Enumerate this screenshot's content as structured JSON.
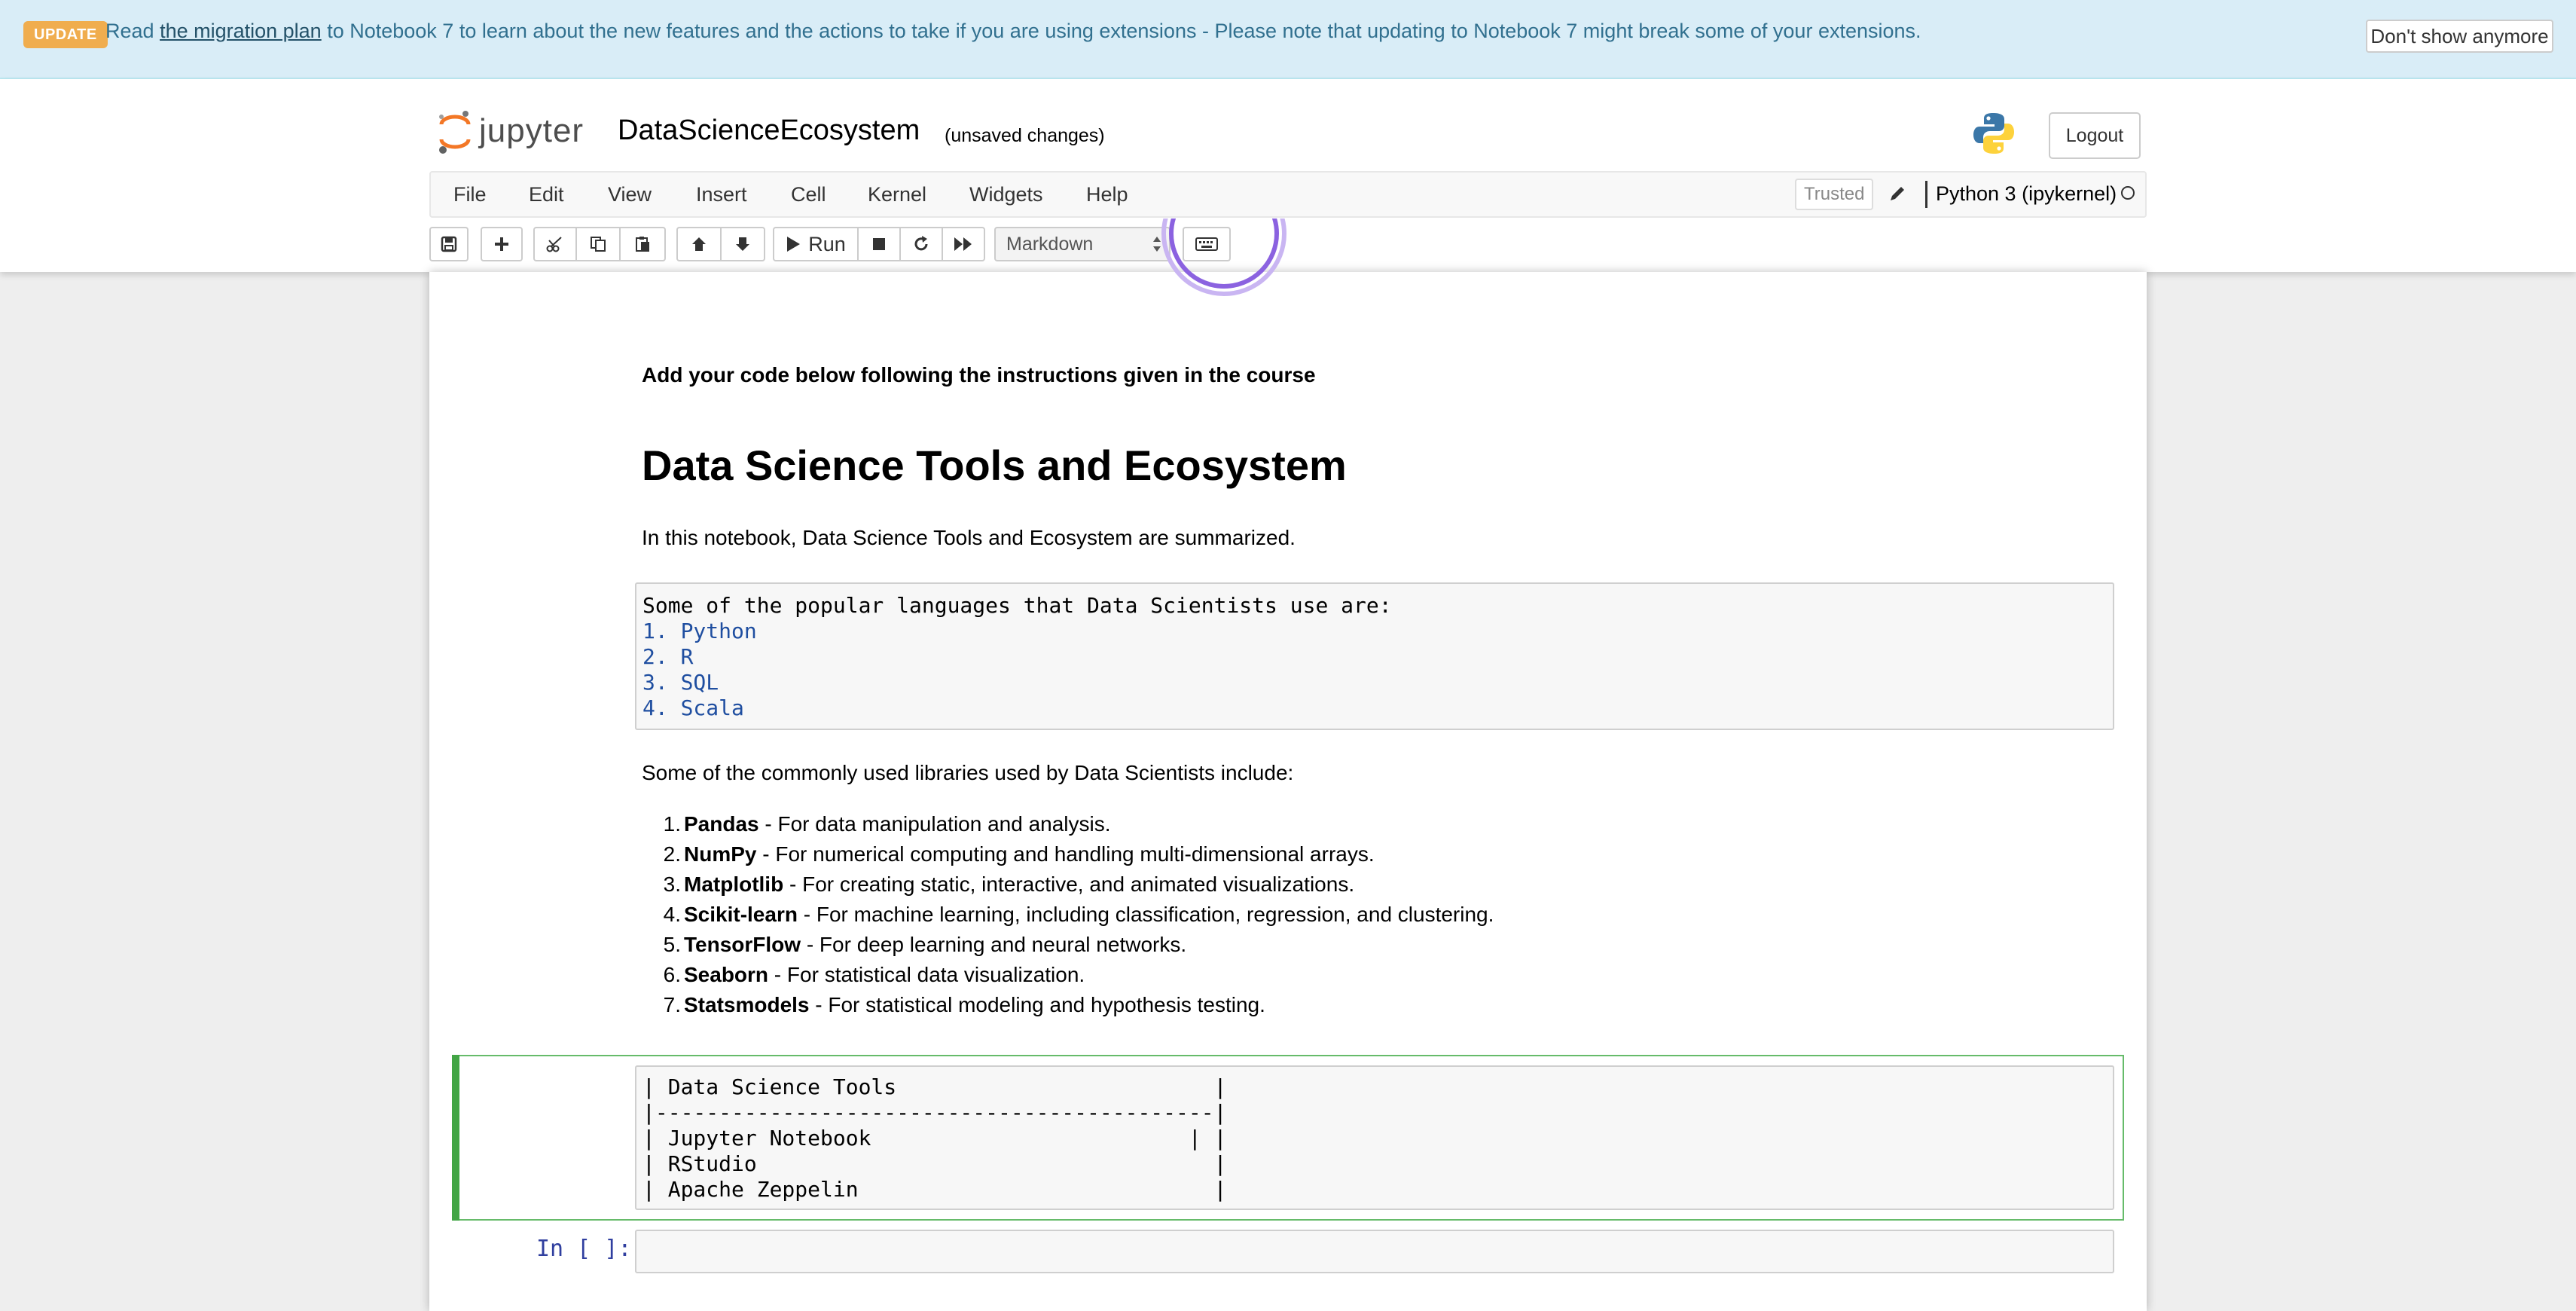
{
  "banner": {
    "badge": "UPDATE",
    "msg_before": "Read ",
    "link": "the migration plan",
    "msg_after": " to Notebook 7 to learn about the new features and the actions to take if you are using extensions - Please note that updating to Notebook 7 might break some of your extensions.",
    "dismiss": "Don't show anymore"
  },
  "header": {
    "logo_text": "jupyter",
    "notebook_name": "DataScienceEcosystem",
    "autosave": "(unsaved changes)",
    "logout": "Logout"
  },
  "menu": {
    "items": [
      "File",
      "Edit",
      "View",
      "Insert",
      "Cell",
      "Kernel",
      "Widgets",
      "Help"
    ],
    "trusted": "Trusted",
    "kernel": "Python 3 (ipykernel)"
  },
  "toolbar": {
    "run_label": "Run",
    "cell_type": "Markdown"
  },
  "notebook": {
    "instruction": "Add your code below following the instructions given in the course",
    "heading": "Data Science Tools and Ecosystem",
    "intro": "In this notebook, Data Science Tools and Ecosystem are summarized.",
    "languages_cell": {
      "lines": [
        "Some of the popular languages that Data Scientists use are:",
        "1. Python",
        "2. R",
        "3. SQL",
        "4. Scala"
      ]
    },
    "libraries_intro": "Some of the commonly used libraries used by Data Scientists include:",
    "libraries": [
      {
        "num": "1.",
        "name": "Pandas",
        "desc": " - For data manipulation and analysis."
      },
      {
        "num": "2.",
        "name": "NumPy",
        "desc": " - For numerical computing and handling multi-dimensional arrays."
      },
      {
        "num": "3.",
        "name": "Matplotlib",
        "desc": " - For creating static, interactive, and animated visualizations."
      },
      {
        "num": "4.",
        "name": "Scikit-learn",
        "desc": " - For machine learning, including classification, regression, and clustering."
      },
      {
        "num": "5.",
        "name": "TensorFlow",
        "desc": " - For deep learning and neural networks."
      },
      {
        "num": "6.",
        "name": "Seaborn",
        "desc": " - For statistical data visualization."
      },
      {
        "num": "7.",
        "name": "Statsmodels",
        "desc": " - For statistical modeling and hypothesis testing."
      }
    ],
    "tools_cell": {
      "lines": [
        "| Data Science Tools                         |",
        "|--------------------------------------------|",
        "| Jupyter Notebook                         | |",
        "| RStudio                                    |",
        "| Apache Zeppelin                            |"
      ]
    },
    "prompt": "In [ ]:"
  },
  "colors": {
    "banner_bg": "#d9edf7",
    "badge": "#f0ad4e",
    "selected_cell": "#42a545",
    "prompt": "#303f9f"
  }
}
